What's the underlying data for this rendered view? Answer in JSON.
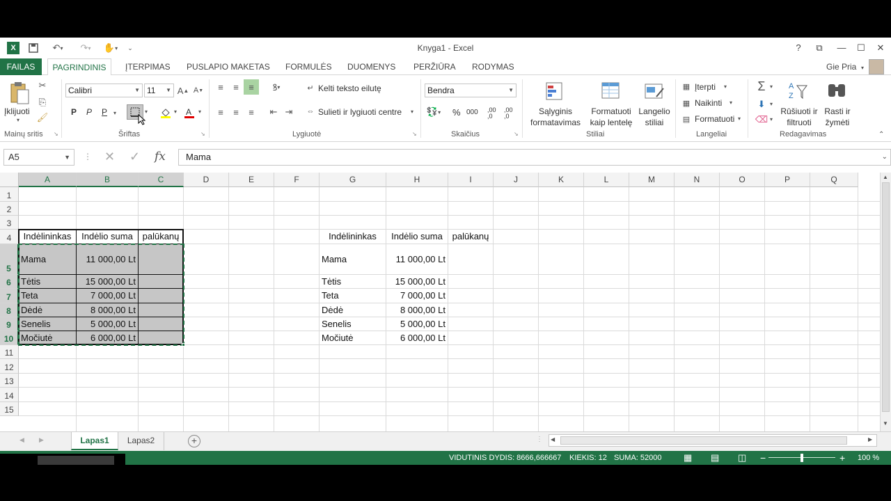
{
  "window": {
    "title": "Knyga1 - Excel",
    "user": "Gie Pria",
    "accent": "#217346"
  },
  "menu": {
    "file": "FAILAS",
    "tabs": [
      "PAGRINDINIS",
      "ĮTERPIMAS",
      "PUSLAPIO MAKETAS",
      "FORMULĖS",
      "DUOMENYS",
      "PERŽIŪRA",
      "RODYMAS"
    ]
  },
  "ribbon": {
    "clipboard": {
      "paste": "Įklijuoti",
      "group": "Mainų sritis"
    },
    "font": {
      "name": "Calibri",
      "size": "11",
      "bold": "P",
      "italic": "P",
      "underline": "P",
      "group": "Šriftas"
    },
    "alignment": {
      "wrap": "Kelti teksto eilutę",
      "merge": "Sulieti ir lygiuoti centre",
      "group": "Lygiuotė"
    },
    "number": {
      "format": "Bendra",
      "percent": "%",
      "thousands": "000",
      "inc": ",00 ,0",
      "dec": ",00 ,0",
      "group": "Skaičius"
    },
    "styles": {
      "conditional": "Sąlyginis formatavimas",
      "format_table": "Formatuoti kaip lentelę",
      "cell_styles": "Langelio stiliai",
      "group": "Stiliai"
    },
    "cells": {
      "insert": "Įterpti",
      "delete": "Naikinti",
      "format": "Formatuoti",
      "group": "Langeliai"
    },
    "editing": {
      "sort": "Rūšiuoti ir filtruoti",
      "find": "Rasti ir žymėti",
      "group": "Redagavimas"
    }
  },
  "formula_bar": {
    "name_box": "A5",
    "content": "Mama"
  },
  "columns": [
    "A",
    "B",
    "C",
    "D",
    "E",
    "F",
    "G",
    "H",
    "I",
    "J",
    "K",
    "L",
    "M",
    "N",
    "O",
    "P",
    "Q"
  ],
  "rows": [
    "1",
    "2",
    "3",
    "4",
    "5",
    "6",
    "7",
    "8",
    "9",
    "10",
    "11",
    "12",
    "13",
    "14",
    "15"
  ],
  "table_left": {
    "headers": [
      "Indėlininkas",
      "Indėlio suma",
      "Metinių palūkanų suma"
    ],
    "rows": [
      [
        "Mama",
        "11 000,00 Lt"
      ],
      [
        "Tėtis",
        "15 000,00 Lt"
      ],
      [
        "Teta",
        "7 000,00 Lt"
      ],
      [
        "Dėdė",
        "8 000,00 Lt"
      ],
      [
        "Senelis",
        "5 000,00 Lt"
      ],
      [
        "Močiutė",
        "6 000,00 Lt"
      ]
    ]
  },
  "table_right": {
    "headers": [
      "Indėlininkas",
      "Indėlio suma",
      "Metinių palūkanų suma"
    ],
    "rows": [
      [
        "Mama",
        "11 000,00 Lt"
      ],
      [
        "Tėtis",
        "15 000,00 Lt"
      ],
      [
        "Teta",
        "7 000,00 Lt"
      ],
      [
        "Dėdė",
        "8 000,00 Lt"
      ],
      [
        "Senelis",
        "5 000,00 Lt"
      ],
      [
        "Močiutė",
        "6 000,00 Lt"
      ]
    ]
  },
  "sheets": [
    "Lapas1",
    "Lapas2"
  ],
  "status": {
    "average": "VIDUTINIS DYDIS: 8666,666667",
    "count": "KIEKIS: 12",
    "sum": "SUMA: 52000",
    "zoom": "100 %"
  }
}
